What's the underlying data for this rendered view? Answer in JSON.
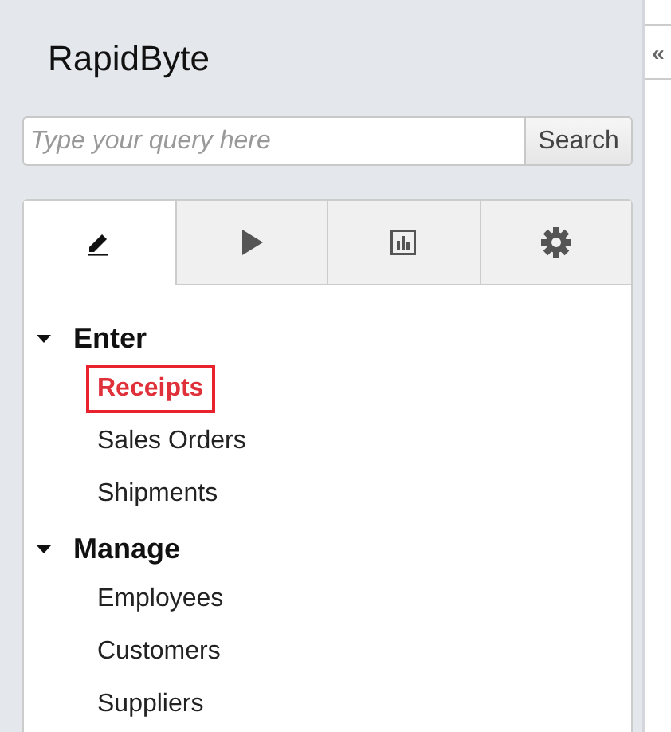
{
  "app": {
    "title": "RapidByte"
  },
  "collapse_button": {
    "label": "«"
  },
  "search": {
    "placeholder": "Type your query here",
    "button": "Search"
  },
  "tabs": [
    {
      "selected": true
    },
    {
      "selected": false
    },
    {
      "selected": false
    },
    {
      "selected": false
    }
  ],
  "tree": [
    {
      "label": "Enter",
      "expanded": true,
      "children": [
        {
          "label": "Receipts",
          "selected": true
        },
        {
          "label": "Sales Orders",
          "selected": false
        },
        {
          "label": "Shipments",
          "selected": false
        }
      ]
    },
    {
      "label": "Manage",
      "expanded": true,
      "children": [
        {
          "label": "Employees",
          "selected": false
        },
        {
          "label": "Customers",
          "selected": false
        },
        {
          "label": "Suppliers",
          "selected": false
        }
      ]
    }
  ]
}
